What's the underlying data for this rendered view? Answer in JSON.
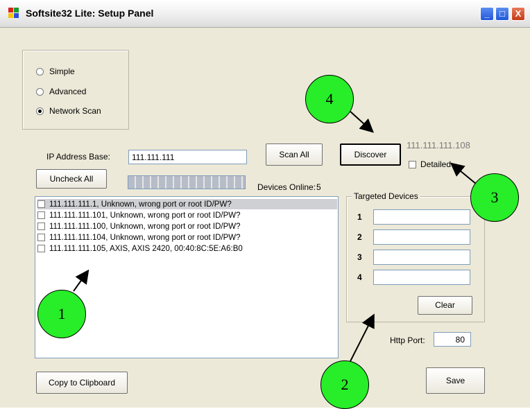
{
  "window": {
    "title": "Softsite32 Lite: Setup Panel",
    "controls": {
      "minimize": "_",
      "maximize": "□",
      "close": "X"
    }
  },
  "mode": {
    "options": [
      "Simple",
      "Advanced",
      "Network Scan"
    ],
    "selected": "Network Scan"
  },
  "scan": {
    "ip_base_label": "IP Address Base:",
    "ip_base_value": "111.111.111",
    "scan_all_label": "Scan All",
    "discover_label": "Discover",
    "uncheck_all_label": "Uncheck All",
    "devices_online_label": "Devices Online:",
    "devices_online_count": "5",
    "discovered_ip": "111.111.111.108",
    "detailed_label": "Detailed",
    "detailed_checked": false
  },
  "device_list": [
    {
      "text": "111.111.111.1, Unknown, wrong port or root ID/PW?",
      "checked": false,
      "selected": true
    },
    {
      "text": "111.111.111.101, Unknown, wrong port or root ID/PW?",
      "checked": false,
      "selected": false
    },
    {
      "text": "111.111.111.100, Unknown, wrong port or root ID/PW?",
      "checked": false,
      "selected": false
    },
    {
      "text": "111.111.111.104, Unknown, wrong port or root ID/PW?",
      "checked": false,
      "selected": false
    },
    {
      "text": "111.111.111.105, AXIS, AXIS 2420, 00:40:8C:5E:A6:B0",
      "checked": false,
      "selected": false
    }
  ],
  "targeted": {
    "title": "Targeted Devices",
    "rows": [
      {
        "label": "1",
        "value": ""
      },
      {
        "label": "2",
        "value": ""
      },
      {
        "label": "3",
        "value": ""
      },
      {
        "label": "4",
        "value": ""
      }
    ],
    "clear_label": "Clear"
  },
  "http": {
    "label": "Http Port:",
    "value": "80"
  },
  "footer": {
    "copy_label": "Copy to Clipboard",
    "save_label": "Save"
  },
  "callouts": [
    "1",
    "2",
    "3",
    "4"
  ],
  "colors": {
    "callout": "#27ee28",
    "list_selected": "#cfd0d3",
    "ip_text": "#7a7a7a"
  }
}
